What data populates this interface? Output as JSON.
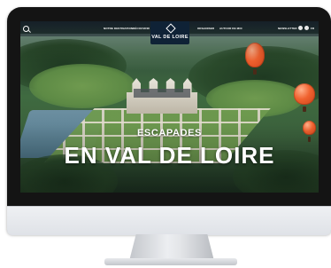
{
  "site": {
    "logo_text": "VAL DE LOIRE",
    "nav_left": [
      "NOTRE DESTINATION",
      "DÉCOUVRIR"
    ],
    "nav_right": [
      "ORGANISER",
      "AUTOUR DE MOI"
    ],
    "nav_pro": "NEWSLETTER",
    "lang": "FR"
  },
  "hero": {
    "kicker": "ESCAPADES",
    "title": "EN VAL DE LOIRE"
  },
  "icons": {
    "search": "search-icon",
    "logo": "logo-icon",
    "user": "user-icon",
    "favorite": "heart-icon"
  },
  "colors": {
    "nav_bg": "#0f2236",
    "balloon": "#f0622f",
    "monitor_bezel": "#141414"
  }
}
